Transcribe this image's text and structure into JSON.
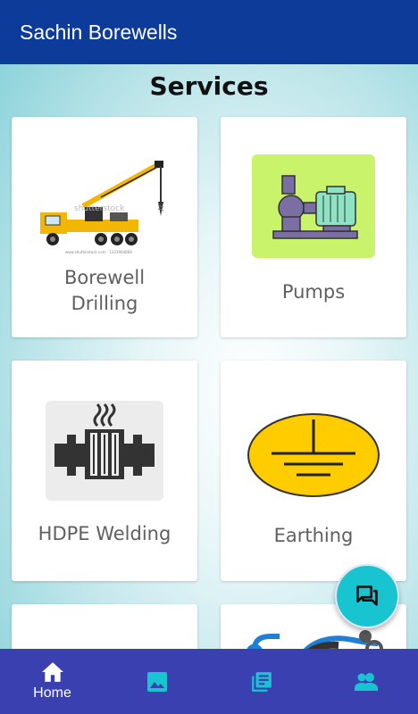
{
  "app": {
    "title": "Sachin Borewells"
  },
  "page": {
    "title": "Services"
  },
  "services": [
    {
      "label": "Borewell Drilling",
      "label_line1": "Borewell",
      "label_line2": "Drilling",
      "image": "drilling-truck-icon"
    },
    {
      "label": "Pumps",
      "image": "pump-icon"
    },
    {
      "label": "HDPE Welding",
      "image": "hdpe-welding-icon"
    },
    {
      "label": "Earthing",
      "image": "earthing-icon"
    },
    {
      "label": "",
      "image": ""
    },
    {
      "label": "",
      "image": "pipe-fitting-icon"
    }
  ],
  "fab": {
    "icon": "chat-icon"
  },
  "bottom_nav": {
    "items": [
      {
        "label": "Home",
        "icon": "home-icon",
        "active": true
      },
      {
        "label": "",
        "icon": "gallery-icon"
      },
      {
        "label": "",
        "icon": "library-icon"
      },
      {
        "label": "",
        "icon": "people-icon"
      }
    ]
  },
  "colors": {
    "appbar": "#0d3b99",
    "bottom_nav": "#3a40b0",
    "fab": "#17c4cf",
    "card_label": "#5f5f5f"
  }
}
